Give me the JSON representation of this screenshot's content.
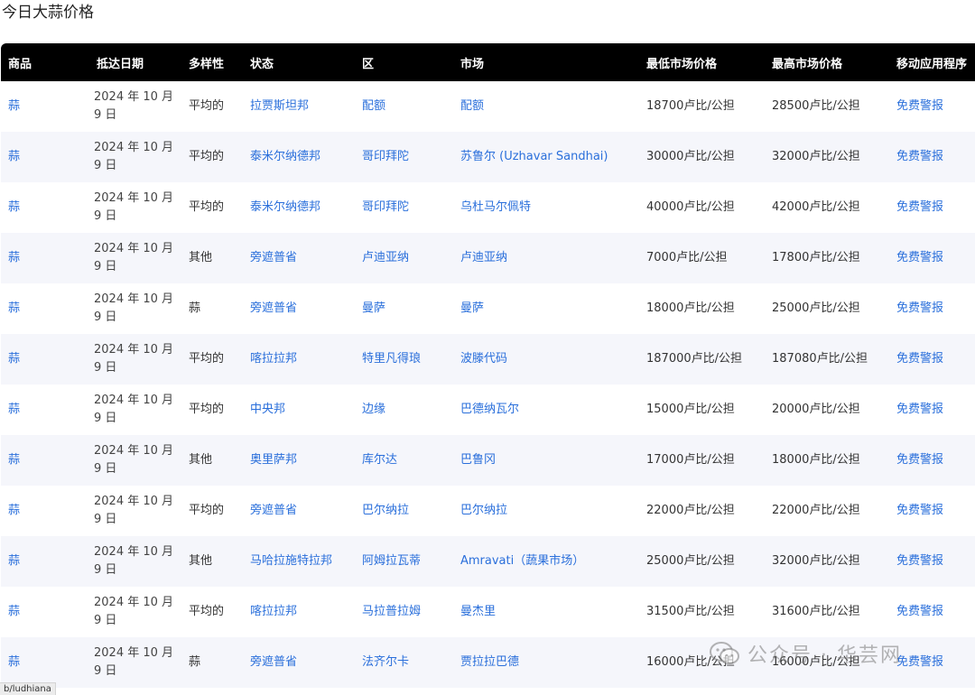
{
  "page": {
    "title": "今日大蒜价格"
  },
  "table": {
    "headers": [
      "商品",
      "抵达日期",
      "多样性",
      "状态",
      "区",
      "市场",
      "最低市场价格",
      "最高市场价格",
      "移动应用程序"
    ],
    "rows": [
      {
        "commodity": "蒜",
        "date": "2024 年 10 月 9 日",
        "variety": "平均的",
        "state": "拉贾斯坦邦",
        "district": "配额",
        "market": "配额",
        "min_price": "18700卢比/公担",
        "max_price": "28500卢比/公担",
        "app": "免费警报"
      },
      {
        "commodity": "蒜",
        "date": "2024 年 10 月 9 日",
        "variety": "平均的",
        "state": "泰米尔纳德邦",
        "district": "哥印拜陀",
        "market": "苏鲁尔 (Uzhavar Sandhai)",
        "min_price": "30000卢比/公担",
        "max_price": "32000卢比/公担",
        "app": "免费警报"
      },
      {
        "commodity": "蒜",
        "date": "2024 年 10 月 9 日",
        "variety": "平均的",
        "state": "泰米尔纳德邦",
        "district": "哥印拜陀",
        "market": "乌杜马尔佩特",
        "min_price": "40000卢比/公担",
        "max_price": "42000卢比/公担",
        "app": "免费警报"
      },
      {
        "commodity": "蒜",
        "date": "2024 年 10 月 9 日",
        "variety": "其他",
        "state": "旁遮普省",
        "district": "卢迪亚纳",
        "market": "卢迪亚纳",
        "min_price": "7000卢比/公担",
        "max_price": "17800卢比/公担",
        "app": "免费警报"
      },
      {
        "commodity": "蒜",
        "date": "2024 年 10 月 9 日",
        "variety": "蒜",
        "state": "旁遮普省",
        "district": "曼萨",
        "market": "曼萨",
        "min_price": "18000卢比/公担",
        "max_price": "25000卢比/公担",
        "app": "免费警报"
      },
      {
        "commodity": "蒜",
        "date": "2024 年 10 月 9 日",
        "variety": "平均的",
        "state": "喀拉拉邦",
        "district": "特里凡得琅",
        "market": "波滕代码",
        "min_price": "187000卢比/公担",
        "max_price": "187080卢比/公担",
        "app": "免费警报"
      },
      {
        "commodity": "蒜",
        "date": "2024 年 10 月 9 日",
        "variety": "平均的",
        "state": "中央邦",
        "district": "边缘",
        "market": "巴德纳瓦尔",
        "min_price": "15000卢比/公担",
        "max_price": "20000卢比/公担",
        "app": "免费警报"
      },
      {
        "commodity": "蒜",
        "date": "2024 年 10 月 9 日",
        "variety": "其他",
        "state": "奥里萨邦",
        "district": "库尔达",
        "market": "巴鲁冈",
        "min_price": "17000卢比/公担",
        "max_price": "18000卢比/公担",
        "app": "免费警报"
      },
      {
        "commodity": "蒜",
        "date": "2024 年 10 月 9 日",
        "variety": "平均的",
        "state": "旁遮普省",
        "district": "巴尔纳拉",
        "market": "巴尔纳拉",
        "min_price": "22000卢比/公担",
        "max_price": "22000卢比/公担",
        "app": "免费警报"
      },
      {
        "commodity": "蒜",
        "date": "2024 年 10 月 9 日",
        "variety": "其他",
        "state": "马哈拉施特拉邦",
        "district": "阿姆拉瓦蒂",
        "market": "Amravati（蔬果市场）",
        "min_price": "25000卢比/公担",
        "max_price": "32000卢比/公担",
        "app": "免费警报"
      },
      {
        "commodity": "蒜",
        "date": "2024 年 10 月 9 日",
        "variety": "平均的",
        "state": "喀拉拉邦",
        "district": "马拉普拉姆",
        "market": "曼杰里",
        "min_price": "31500卢比/公担",
        "max_price": "31600卢比/公担",
        "app": "免费警报"
      },
      {
        "commodity": "蒜",
        "date": "2024 年 10 月 9 日",
        "variety": "蒜",
        "state": "旁遮普省",
        "district": "法齐尔卡",
        "market": "贾拉拉巴德",
        "min_price": "16000卢比/公担",
        "max_price": "16000卢比/公担",
        "app": "免费警报"
      }
    ]
  },
  "status_bar": {
    "url_hint": "b/ludhiana"
  },
  "watermark": {
    "text": "公众号 · 华芸网"
  },
  "colors": {
    "link": "#2a6fdb",
    "header_bg": "#000000",
    "alt_row": "#f5f6fb"
  }
}
